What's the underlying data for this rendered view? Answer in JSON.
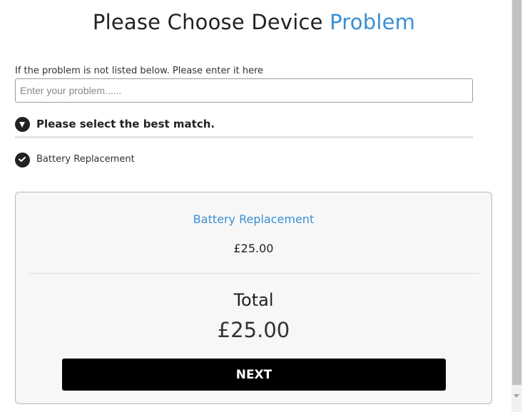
{
  "header": {
    "title_part1": "Please Choose Device",
    "title_part2": "Problem",
    "accent_color": "#3a8fd4"
  },
  "problem_entry": {
    "prompt": "If the problem is not listed below. Please enter it here",
    "placeholder": "Enter your problem......",
    "value": ""
  },
  "match_section": {
    "label": "Please select the best match.",
    "icon": "chevron-down-circle-icon"
  },
  "options": [
    {
      "label": "Battery Replacement",
      "selected": true,
      "icon": "check-circle-icon"
    }
  ],
  "summary": {
    "item_name": "Battery Replacement",
    "item_price": "£25.00",
    "total_label": "Total",
    "total_value": "£25.00",
    "next_label": "NEXT"
  }
}
